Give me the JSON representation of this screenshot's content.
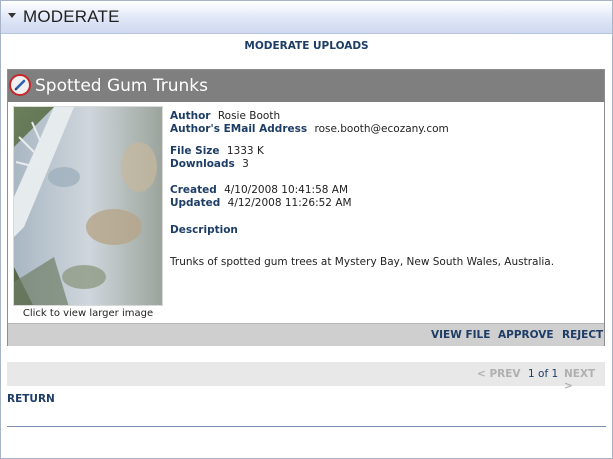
{
  "module": {
    "title": "MODERATE"
  },
  "section": {
    "title": "MODERATE UPLOADS"
  },
  "item": {
    "title": "Spotted Gum Trunks",
    "thumbnail_caption": "Click to view larger image",
    "author_label": "Author",
    "author": "Rosie Booth",
    "email_label": "Author's EMail Address",
    "email": "rose.booth@ecozany.com",
    "filesize_label": "File Size",
    "filesize": "1333 K",
    "downloads_label": "Downloads",
    "downloads": "3",
    "created_label": "Created",
    "created": "4/10/2008 10:41:58 AM",
    "updated_label": "Updated",
    "updated": "4/12/2008 11:26:52 AM",
    "description_label": "Description",
    "description": "Trunks of spotted gum trees at Mystery Bay, New South Wales, Australia.",
    "actions": {
      "view": "VIEW FILE",
      "approve": "APPROVE",
      "reject": "REJECT"
    }
  },
  "pager": {
    "prev": "< PREV",
    "info": "1 of 1",
    "next": "NEXT >"
  },
  "return_label": "RETURN",
  "icons": {
    "collapse": "triangle-down-icon",
    "edit": "pencil-icon"
  },
  "colors": {
    "link": "#1d3d66",
    "titlebar": "#7f7f7f",
    "footer": "#cfcfcf",
    "edit_ring": "#c8272b"
  }
}
